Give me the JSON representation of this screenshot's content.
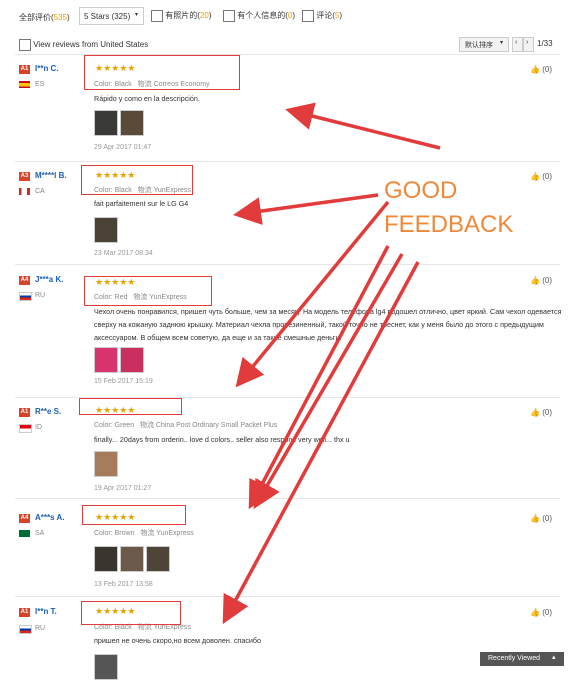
{
  "filters": {
    "all_label": "全部评价",
    "all_count": "535",
    "stars_select": "5 Stars (325)",
    "with_photos_label": "有照片的",
    "with_photos_count": "20",
    "personal_label": "有个人信息的",
    "personal_count": "0",
    "other_label": "评论",
    "other_count": "5",
    "view_us_label": "View reviews from United States",
    "sort_label": "默认排序",
    "page_info": "1/33"
  },
  "reviews": [
    {
      "level": "A1",
      "user": "I**n C.",
      "country": "ES",
      "stars": "★★★★★",
      "color_label": "Color:",
      "color": "Black",
      "logistics_label": "物流",
      "logistics": "Correos Economy",
      "text": "Rápido y como en la descripción.",
      "date": "29 Apr 2017 01:47",
      "likes": "(0)"
    },
    {
      "level": "A3",
      "user": "M****l B.",
      "country": "CA",
      "stars": "★★★★★",
      "color_label": "Color:",
      "color": "Black",
      "logistics_label": "物流",
      "logistics": "YunExpress",
      "text": "fait parfaitement sur le LG G4",
      "date": "23 Mar 2017 08:34",
      "likes": "(0)"
    },
    {
      "level": "A4",
      "user": "J***a K.",
      "country": "RU",
      "stars": "★★★★★",
      "color_label": "Color:",
      "color": "Red",
      "logistics_label": "物流",
      "logistics": "YunExpress",
      "text": "Чехол очень понравился, пришел чуть больше, чем за месяц. На модель телефона lg4 подошел отлично, цвет яркий. Сам чехол одевается сверху на кожаную заднюю крышку. Материал чехла прорезиненный, такой точно не треснет, как у меня было до этого с предыдущим аксессуаром. В общем всем советую, да еще и за такие смешные деньги.",
      "date": "15 Feb 2017 15:19",
      "likes": "(0)"
    },
    {
      "level": "A1",
      "user": "R**e S.",
      "country": "ID",
      "stars": "★★★★★",
      "color_label": "Color:",
      "color": "Green",
      "logistics_label": "物流",
      "logistics": "China Post Ordinary Small Packet Plus",
      "text": "finally... 20days from orderin.. love d colors.. seller also respons very well... thx u",
      "date": "19 Apr 2017 01:27",
      "likes": "(0)"
    },
    {
      "level": "A4",
      "user": "A***s A.",
      "country": "SA",
      "stars": "★★★★★",
      "color_label": "Color:",
      "color": "Brown",
      "logistics_label": "物流",
      "logistics": "YunExpress",
      "text": "",
      "date": "13 Feb 2017 13:58",
      "likes": "(0)"
    },
    {
      "level": "A1",
      "user": "I**n T.",
      "country": "RU",
      "stars": "★★★★★",
      "color_label": "Color:",
      "color": "Black",
      "logistics_label": "物流",
      "logistics": "YunExpress",
      "text": "пришел не очень скоро,но всем доволен. спасибо",
      "date": "",
      "likes": "(0)"
    }
  ],
  "annotation": {
    "line1": "GOOD",
    "line2": "FEEDBACK",
    "color": "#f0883a",
    "arrow_color": "#e23b3b"
  },
  "recently_viewed": "Recently Viewed"
}
